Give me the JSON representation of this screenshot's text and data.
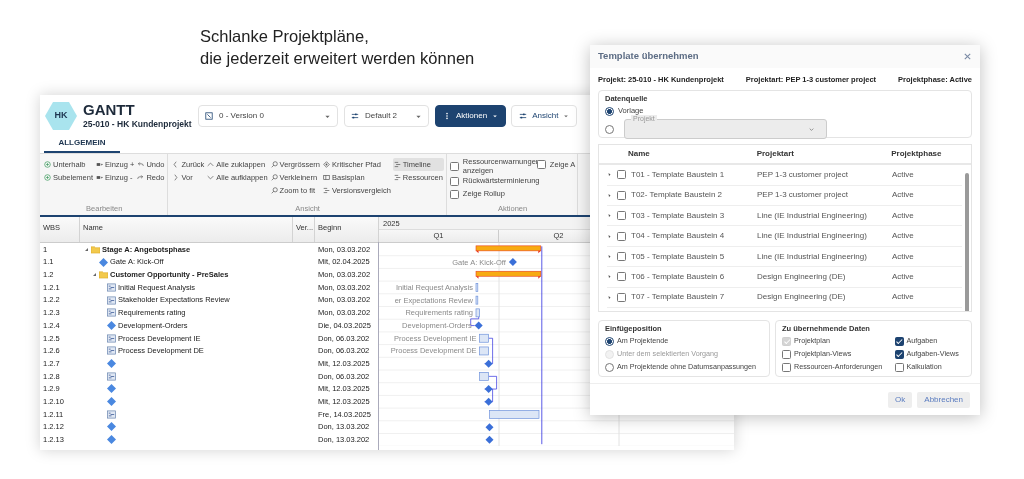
{
  "headline": [
    "Schlanke Projektpläne,",
    "die jederzeit erweitert werden können"
  ],
  "app": {
    "logo": "HK",
    "title": "GANTT",
    "subtitle": "25-010 - HK Kundenprojekt",
    "dropdowns": [
      {
        "value": "0 - Version 0"
      },
      {
        "value": "Default 2"
      }
    ],
    "buttons": [
      {
        "label": "Aktionen",
        "primary": true
      },
      {
        "label": "Ansicht",
        "primary": false
      }
    ],
    "tabs": [
      {
        "label": "ALLGEMEIN",
        "selected": true
      }
    ]
  },
  "ribbon": [
    {
      "title": "Bearbeiten",
      "columns": [
        [
          {
            "label": "Unterhalb"
          },
          {
            "label": "Subelement"
          }
        ],
        [
          {
            "label": "Einzug +"
          },
          {
            "label": "Einzug -"
          }
        ],
        [
          {
            "label": "Undo"
          },
          {
            "label": "Redo"
          }
        ]
      ]
    },
    {
      "title": "Ansicht",
      "columns": [
        [
          {
            "label": "Zurück"
          },
          {
            "label": "Vor"
          }
        ],
        [
          {
            "label": "Alle zuklappen"
          },
          {
            "label": "Alle aufklappen"
          }
        ],
        [
          {
            "label": "Vergrössern"
          },
          {
            "label": "Verkleinern"
          },
          {
            "label": "Zoom to fit"
          }
        ],
        [
          {
            "label": "Kritischer Pfad"
          },
          {
            "label": "Basisplan"
          },
          {
            "label": "Versionsvergleich"
          }
        ],
        [
          {
            "label": "Timeline",
            "selected": true
          },
          {
            "label": "Ressourcen",
            "selected": false
          }
        ]
      ]
    },
    {
      "title": "Aktionen",
      "columns": [
        [
          {
            "label": "Ressourcenwarnungen anzeigen",
            "checked": false
          },
          {
            "label": "Rückwärtsterminierung",
            "checked": false
          },
          {
            "label": "Zeige Rollup",
            "checked": false
          }
        ],
        [
          {
            "label": "Zeige A",
            "checked": false
          }
        ]
      ]
    }
  ],
  "grid": {
    "columns": [
      "WBS",
      "Name",
      "Ver...",
      "Beginn"
    ],
    "rows": [
      {
        "wbs": "1",
        "name": "Stage A: Angebotsphase",
        "begin": "Mon, 03.03.202",
        "kind": "summary",
        "expanded": true,
        "children": [
          {
            "wbs": "1.1",
            "name": "Gate A: Kick-Off",
            "begin": "Mit, 02.04.2025",
            "kind": "milestone",
            "chart_label": "Gate A: Kick-Off"
          },
          {
            "wbs": "1.2",
            "name": "Customer Opportunity - PreSales",
            "begin": "Mon, 03.03.202",
            "kind": "summary",
            "expanded": true,
            "children": [
              {
                "wbs": "1.2.1",
                "name": "Initial Request Analysis",
                "begin": "Mon, 03.03.202",
                "kind": "task",
                "chart_label": "Initial Request Analysis"
              },
              {
                "wbs": "1.2.2",
                "name": "Stakeholder Expectations Review",
                "begin": "Mon, 03.03.202",
                "kind": "task",
                "chart_label": "er Expectations Review"
              },
              {
                "wbs": "1.2.3",
                "name": "Requirements rating",
                "begin": "Mon, 03.03.202",
                "kind": "task",
                "chart_label": "Requirements rating"
              },
              {
                "wbs": "1.2.4",
                "name": "Development-Orders",
                "begin": "Die, 04.03.2025",
                "kind": "milestone",
                "chart_label": "Development-Orders"
              },
              {
                "wbs": "1.2.5",
                "name": "Process Development IE",
                "begin": "Don, 06.03.202",
                "kind": "task",
                "chart_label": "Process Development IE"
              },
              {
                "wbs": "1.2.6",
                "name": "Process Development DE",
                "begin": "Don, 06.03.202",
                "kind": "task",
                "chart_label": "Process Development DE"
              },
              {
                "wbs": "1.2.7",
                "begin": "Mit, 12.03.2025",
                "kind": "milestone"
              },
              {
                "wbs": "1.2.8",
                "begin": "Don, 06.03.202",
                "kind": "task"
              },
              {
                "wbs": "1.2.9",
                "begin": "Mit, 12.03.2025",
                "kind": "milestone"
              },
              {
                "wbs": "1.2.10",
                "begin": "Mit, 12.03.2025",
                "kind": "milestone"
              },
              {
                "wbs": "1.2.11",
                "begin": "Fre, 14.03.2025",
                "kind": "task"
              },
              {
                "wbs": "1.2.12",
                "begin": "Don, 13.03.202",
                "kind": "milestone"
              },
              {
                "wbs": "1.2.13",
                "begin": "Don, 13.03.202",
                "kind": "milestone"
              }
            ]
          }
        ]
      }
    ]
  },
  "timeline": {
    "year": "2025",
    "quarters": [
      "Q1",
      "Q2"
    ]
  },
  "dialog": {
    "title": "Template übernehmen",
    "info": [
      "Projekt: 25-010 - HK Kundenprojekt",
      "Projektart: PEP 1-3 customer project",
      "Projektphase: Active"
    ],
    "data_source": {
      "legend": "Datenquelle",
      "options": [
        {
          "kind": "radio",
          "label": "Vorlage",
          "selected": true
        },
        {
          "kind": "select",
          "label": "Projekt",
          "selected": false,
          "disabled": true
        }
      ]
    },
    "templates": {
      "columns": [
        "Name",
        "Projektart",
        "Projektphase"
      ],
      "rows": [
        {
          "name": "T01 - Template Baustein 1",
          "type": "PEP 1-3 customer project",
          "phase": "Active",
          "checked": false
        },
        {
          "name": "T02- Template Baustein 2",
          "type": "PEP 1-3 customer project",
          "phase": "Active",
          "checked": false
        },
        {
          "name": "T03 - Template Baustein 3",
          "type": "Line (IE Industrial Engineering)",
          "phase": "Active",
          "checked": false
        },
        {
          "name": "T04 - Template Baustein 4",
          "type": "Line (IE Industrial Engineering)",
          "phase": "Active",
          "checked": false
        },
        {
          "name": "T05 - Template Baustein 5",
          "type": "Line (IE Industrial Engineering)",
          "phase": "Active",
          "checked": false
        },
        {
          "name": "T06 - Template Baustein 6",
          "type": "Design Engineering (DE)",
          "phase": "Active",
          "checked": false
        },
        {
          "name": "T07 - Template Baustein 7",
          "type": "Design Engineering (DE)",
          "phase": "Active",
          "checked": false
        }
      ]
    },
    "insert_position": {
      "legend": "Einfügeposition",
      "options": [
        {
          "label": "Am Projektende",
          "selected": true,
          "disabled": false
        },
        {
          "label": "Unter dem selektierten Vorgang",
          "selected": false,
          "disabled": true
        },
        {
          "label": "Am Projektende ohne Datumsanpassungen",
          "selected": false,
          "disabled": false
        }
      ]
    },
    "transfer_data": {
      "legend": "Zu übernehmende Daten",
      "items": [
        {
          "label": "Projektplan",
          "checked": true,
          "disabled": true
        },
        {
          "label": "Aufgaben",
          "checked": true,
          "disabled": false
        },
        {
          "label": "Projektplan-Views",
          "checked": false,
          "disabled": false
        },
        {
          "label": "Aufgaben-Views",
          "checked": true,
          "disabled": false
        },
        {
          "label": "Ressourcen-Anforderungen",
          "checked": false,
          "disabled": false
        },
        {
          "label": "Kalkulation",
          "checked": false,
          "disabled": false
        }
      ]
    },
    "buttons": [
      "Ok",
      "Abbrechen"
    ]
  }
}
